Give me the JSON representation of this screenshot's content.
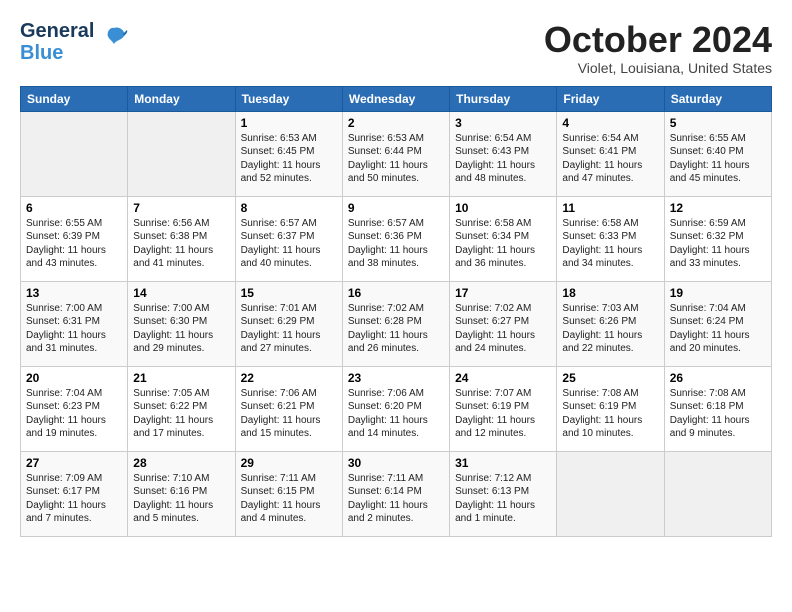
{
  "header": {
    "logo_line1": "General",
    "logo_line2": "Blue",
    "month": "October 2024",
    "location": "Violet, Louisiana, United States"
  },
  "days_of_week": [
    "Sunday",
    "Monday",
    "Tuesday",
    "Wednesday",
    "Thursday",
    "Friday",
    "Saturday"
  ],
  "weeks": [
    [
      {
        "day": "",
        "empty": true
      },
      {
        "day": "",
        "empty": true
      },
      {
        "day": "1",
        "sunrise": "Sunrise: 6:53 AM",
        "sunset": "Sunset: 6:45 PM",
        "daylight": "Daylight: 11 hours and 52 minutes."
      },
      {
        "day": "2",
        "sunrise": "Sunrise: 6:53 AM",
        "sunset": "Sunset: 6:44 PM",
        "daylight": "Daylight: 11 hours and 50 minutes."
      },
      {
        "day": "3",
        "sunrise": "Sunrise: 6:54 AM",
        "sunset": "Sunset: 6:43 PM",
        "daylight": "Daylight: 11 hours and 48 minutes."
      },
      {
        "day": "4",
        "sunrise": "Sunrise: 6:54 AM",
        "sunset": "Sunset: 6:41 PM",
        "daylight": "Daylight: 11 hours and 47 minutes."
      },
      {
        "day": "5",
        "sunrise": "Sunrise: 6:55 AM",
        "sunset": "Sunset: 6:40 PM",
        "daylight": "Daylight: 11 hours and 45 minutes."
      }
    ],
    [
      {
        "day": "6",
        "sunrise": "Sunrise: 6:55 AM",
        "sunset": "Sunset: 6:39 PM",
        "daylight": "Daylight: 11 hours and 43 minutes."
      },
      {
        "day": "7",
        "sunrise": "Sunrise: 6:56 AM",
        "sunset": "Sunset: 6:38 PM",
        "daylight": "Daylight: 11 hours and 41 minutes."
      },
      {
        "day": "8",
        "sunrise": "Sunrise: 6:57 AM",
        "sunset": "Sunset: 6:37 PM",
        "daylight": "Daylight: 11 hours and 40 minutes."
      },
      {
        "day": "9",
        "sunrise": "Sunrise: 6:57 AM",
        "sunset": "Sunset: 6:36 PM",
        "daylight": "Daylight: 11 hours and 38 minutes."
      },
      {
        "day": "10",
        "sunrise": "Sunrise: 6:58 AM",
        "sunset": "Sunset: 6:34 PM",
        "daylight": "Daylight: 11 hours and 36 minutes."
      },
      {
        "day": "11",
        "sunrise": "Sunrise: 6:58 AM",
        "sunset": "Sunset: 6:33 PM",
        "daylight": "Daylight: 11 hours and 34 minutes."
      },
      {
        "day": "12",
        "sunrise": "Sunrise: 6:59 AM",
        "sunset": "Sunset: 6:32 PM",
        "daylight": "Daylight: 11 hours and 33 minutes."
      }
    ],
    [
      {
        "day": "13",
        "sunrise": "Sunrise: 7:00 AM",
        "sunset": "Sunset: 6:31 PM",
        "daylight": "Daylight: 11 hours and 31 minutes."
      },
      {
        "day": "14",
        "sunrise": "Sunrise: 7:00 AM",
        "sunset": "Sunset: 6:30 PM",
        "daylight": "Daylight: 11 hours and 29 minutes."
      },
      {
        "day": "15",
        "sunrise": "Sunrise: 7:01 AM",
        "sunset": "Sunset: 6:29 PM",
        "daylight": "Daylight: 11 hours and 27 minutes."
      },
      {
        "day": "16",
        "sunrise": "Sunrise: 7:02 AM",
        "sunset": "Sunset: 6:28 PM",
        "daylight": "Daylight: 11 hours and 26 minutes."
      },
      {
        "day": "17",
        "sunrise": "Sunrise: 7:02 AM",
        "sunset": "Sunset: 6:27 PM",
        "daylight": "Daylight: 11 hours and 24 minutes."
      },
      {
        "day": "18",
        "sunrise": "Sunrise: 7:03 AM",
        "sunset": "Sunset: 6:26 PM",
        "daylight": "Daylight: 11 hours and 22 minutes."
      },
      {
        "day": "19",
        "sunrise": "Sunrise: 7:04 AM",
        "sunset": "Sunset: 6:24 PM",
        "daylight": "Daylight: 11 hours and 20 minutes."
      }
    ],
    [
      {
        "day": "20",
        "sunrise": "Sunrise: 7:04 AM",
        "sunset": "Sunset: 6:23 PM",
        "daylight": "Daylight: 11 hours and 19 minutes."
      },
      {
        "day": "21",
        "sunrise": "Sunrise: 7:05 AM",
        "sunset": "Sunset: 6:22 PM",
        "daylight": "Daylight: 11 hours and 17 minutes."
      },
      {
        "day": "22",
        "sunrise": "Sunrise: 7:06 AM",
        "sunset": "Sunset: 6:21 PM",
        "daylight": "Daylight: 11 hours and 15 minutes."
      },
      {
        "day": "23",
        "sunrise": "Sunrise: 7:06 AM",
        "sunset": "Sunset: 6:20 PM",
        "daylight": "Daylight: 11 hours and 14 minutes."
      },
      {
        "day": "24",
        "sunrise": "Sunrise: 7:07 AM",
        "sunset": "Sunset: 6:19 PM",
        "daylight": "Daylight: 11 hours and 12 minutes."
      },
      {
        "day": "25",
        "sunrise": "Sunrise: 7:08 AM",
        "sunset": "Sunset: 6:19 PM",
        "daylight": "Daylight: 11 hours and 10 minutes."
      },
      {
        "day": "26",
        "sunrise": "Sunrise: 7:08 AM",
        "sunset": "Sunset: 6:18 PM",
        "daylight": "Daylight: 11 hours and 9 minutes."
      }
    ],
    [
      {
        "day": "27",
        "sunrise": "Sunrise: 7:09 AM",
        "sunset": "Sunset: 6:17 PM",
        "daylight": "Daylight: 11 hours and 7 minutes."
      },
      {
        "day": "28",
        "sunrise": "Sunrise: 7:10 AM",
        "sunset": "Sunset: 6:16 PM",
        "daylight": "Daylight: 11 hours and 5 minutes."
      },
      {
        "day": "29",
        "sunrise": "Sunrise: 7:11 AM",
        "sunset": "Sunset: 6:15 PM",
        "daylight": "Daylight: 11 hours and 4 minutes."
      },
      {
        "day": "30",
        "sunrise": "Sunrise: 7:11 AM",
        "sunset": "Sunset: 6:14 PM",
        "daylight": "Daylight: 11 hours and 2 minutes."
      },
      {
        "day": "31",
        "sunrise": "Sunrise: 7:12 AM",
        "sunset": "Sunset: 6:13 PM",
        "daylight": "Daylight: 11 hours and 1 minute."
      },
      {
        "day": "",
        "empty": true
      },
      {
        "day": "",
        "empty": true
      }
    ]
  ]
}
